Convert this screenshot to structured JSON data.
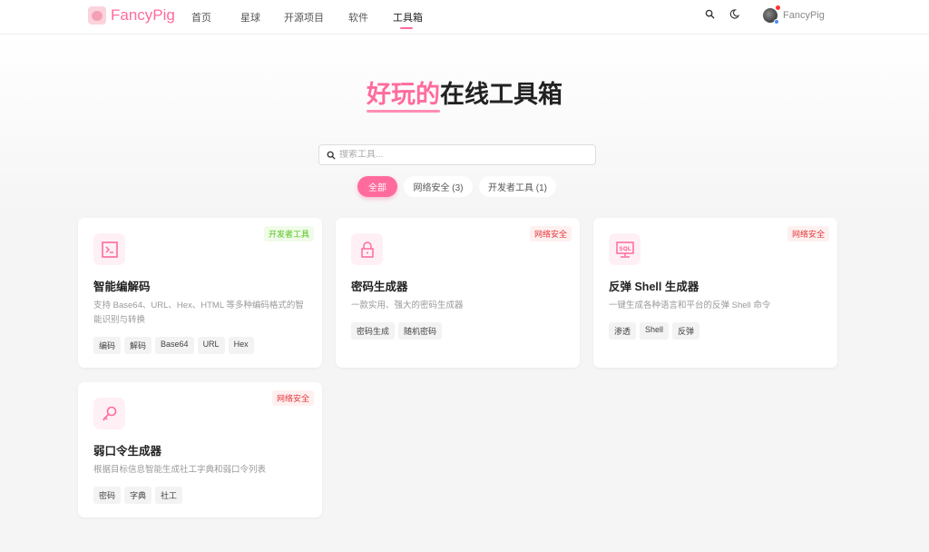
{
  "header": {
    "logo": "FancyPig",
    "nav": [
      "首页",
      "星球",
      "开源项目",
      "软件",
      "工具箱"
    ],
    "active_nav": 4,
    "username": "FancyPig"
  },
  "hero": {
    "title_highlight": "好玩的",
    "title_rest": "在线工具箱"
  },
  "search": {
    "placeholder": "搜索工具..."
  },
  "filters": [
    "全部",
    "网络安全 (3)",
    "开发者工具 (1)"
  ],
  "accent": "#ff6b9d",
  "tools": [
    {
      "name": "智能编解码",
      "desc": "支持 Base64、URL、Hex、HTML 等多种编码格式的智能识别与转换",
      "category": "开发者工具",
      "cat_type": "dev",
      "icon": "terminal-icon",
      "tags": [
        "编码",
        "解码",
        "Base64",
        "URL",
        "Hex"
      ]
    },
    {
      "name": "密码生成器",
      "desc": "一款实用、强大的密码生成器",
      "category": "网络安全",
      "cat_type": "sec",
      "icon": "lock-icon",
      "tags": [
        "密码生成",
        "随机密码"
      ]
    },
    {
      "name": "反弹 Shell 生成器",
      "desc": "一键生成各种语言和平台的反弹 Shell 命令",
      "category": "网络安全",
      "cat_type": "sec",
      "icon": "sql-monitor-icon",
      "tags": [
        "渗透",
        "Shell",
        "反弹"
      ]
    },
    {
      "name": "弱口令生成器",
      "desc": "根据目标信息智能生成社工字典和弱口令列表",
      "category": "网络安全",
      "cat_type": "sec",
      "icon": "key-icon",
      "tags": [
        "密码",
        "字典",
        "社工"
      ]
    }
  ]
}
